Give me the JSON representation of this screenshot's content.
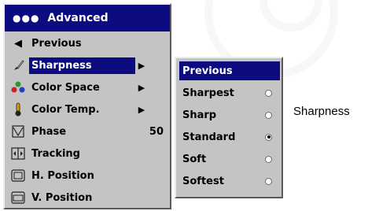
{
  "menu": {
    "title": "Advanced",
    "title_icon": "dots-icon",
    "items": [
      {
        "label": "Previous",
        "icon": "triangle-left-icon",
        "arrow": false,
        "value": ""
      },
      {
        "label": "Sharpness",
        "icon": "paintbrush-icon",
        "arrow": true,
        "value": "",
        "selected": true
      },
      {
        "label": "Color Space",
        "icon": "color-dots-icon",
        "arrow": true,
        "value": ""
      },
      {
        "label": "Color Temp.",
        "icon": "thermometer-icon",
        "arrow": true,
        "value": ""
      },
      {
        "label": "Phase",
        "icon": "phase-icon",
        "arrow": false,
        "value": "50"
      },
      {
        "label": "Tracking",
        "icon": "tracking-icon",
        "arrow": false,
        "value": ""
      },
      {
        "label": "H. Position",
        "icon": "h-position-icon",
        "arrow": false,
        "value": ""
      },
      {
        "label": "V. Position",
        "icon": "v-position-icon",
        "arrow": false,
        "value": ""
      }
    ]
  },
  "submenu": {
    "items": [
      {
        "label": "Previous",
        "selected": true,
        "radio": false
      },
      {
        "label": "Sharpest",
        "radio": true,
        "checked": false
      },
      {
        "label": "Sharp",
        "radio": true,
        "checked": false
      },
      {
        "label": "Standard",
        "radio": true,
        "checked": true
      },
      {
        "label": "Soft",
        "radio": true,
        "checked": false
      },
      {
        "label": "Softest",
        "radio": true,
        "checked": false
      }
    ]
  },
  "caption": "Sharpness",
  "colors": {
    "accent": "#0c0c80",
    "panel": "#c4c4c4"
  }
}
